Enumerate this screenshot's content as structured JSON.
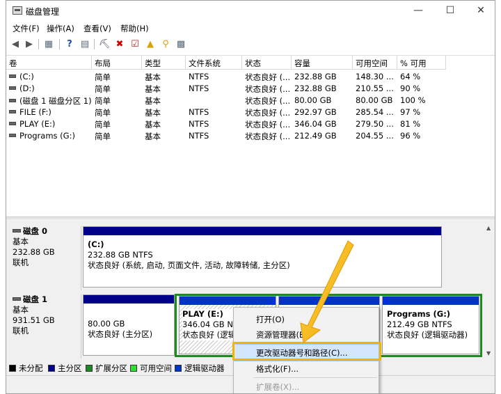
{
  "window": {
    "title": "磁盘管理"
  },
  "menu": [
    "文件(F)",
    "操作(A)",
    "查看(V)",
    "帮助(H)"
  ],
  "volume_table": {
    "columns": [
      "卷",
      "布局",
      "类型",
      "文件系统",
      "状态",
      "容量",
      "可用空间",
      "% 可用"
    ],
    "rows": [
      [
        "(C:)",
        "简单",
        "基本",
        "NTFS",
        "状态良好 (...",
        "232.88 GB",
        "148.30 ...",
        "64 %"
      ],
      [
        "(D:)",
        "简单",
        "基本",
        "NTFS",
        "状态良好 (...",
        "232.88 GB",
        "210.55 ...",
        "90 %"
      ],
      [
        "(磁盘 1 磁盘分区 1)",
        "简单",
        "基本",
        "",
        "状态良好 (...",
        "80.00 GB",
        "80.00 GB",
        "100 %"
      ],
      [
        "FILE (F:)",
        "简单",
        "基本",
        "NTFS",
        "状态良好 (...",
        "292.97 GB",
        "285.54 ...",
        "97 %"
      ],
      [
        "PLAY (E:)",
        "简单",
        "基本",
        "NTFS",
        "状态良好 (...",
        "346.04 GB",
        "279.50 ...",
        "81 %"
      ],
      [
        "Programs (G:)",
        "简单",
        "基本",
        "NTFS",
        "状态良好 (...",
        "212.49 GB",
        "204.55 ...",
        "96 %"
      ]
    ]
  },
  "disks": {
    "disk0": {
      "name": "磁盘 0",
      "type": "基本",
      "size": "232.88 GB",
      "state": "联机",
      "part_c": {
        "name": "(C:)",
        "fs": "232.88 GB NTFS",
        "status": "状态良好 (系统, 启动, 页面文件, 活动, 故障转储, 主分区)"
      }
    },
    "disk1": {
      "name": "磁盘 1",
      "type": "基本",
      "size": "931.51 GB",
      "state": "联机",
      "part1": {
        "fs": "80.00 GB",
        "status": "状态良好 (主分区)"
      },
      "part_e": {
        "name": "PLAY  (E:)",
        "fs": "346.04 GB NTF",
        "status": "状态良好 (逻辑"
      },
      "part_g": {
        "name": "Programs  (G:)",
        "fs": "212.49 GB NTFS",
        "status": "状态良好 (逻辑驱动器)"
      }
    }
  },
  "legend": {
    "items": [
      {
        "label": "未分配",
        "color": "#000000"
      },
      {
        "label": "主分区",
        "color": "#00008b"
      },
      {
        "label": "扩展分区",
        "color": "#1d8a1d"
      },
      {
        "label": "可用空间",
        "color": "#33dd33"
      },
      {
        "label": "逻辑驱动器",
        "color": "#0033cc"
      }
    ]
  },
  "context_menu": {
    "open": "打开(O)",
    "explorer": "资源管理器(E)",
    "change_letter": "更改驱动器号和路径(C)...",
    "format": "格式化(F)...",
    "extend": "扩展卷(X)..."
  },
  "colors": {
    "accent_highlight": "#f4b400",
    "primary_partition": "#00008b",
    "extended_partition": "#1d8a1d"
  }
}
